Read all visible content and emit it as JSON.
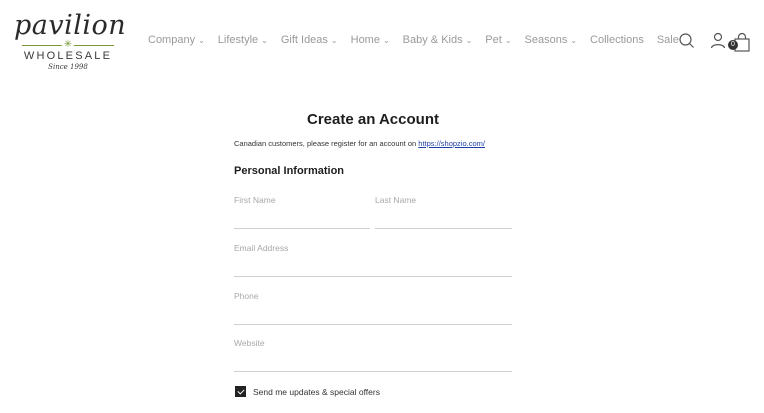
{
  "brand": {
    "name": "pavilion",
    "tagline": "WHOLESALE",
    "since": "Since 1998"
  },
  "nav": {
    "items": [
      {
        "label": "Company",
        "has_dropdown": true
      },
      {
        "label": "Lifestyle",
        "has_dropdown": true
      },
      {
        "label": "Gift Ideas",
        "has_dropdown": true
      },
      {
        "label": "Home",
        "has_dropdown": true
      },
      {
        "label": "Baby & Kids",
        "has_dropdown": true
      },
      {
        "label": "Pet",
        "has_dropdown": true
      },
      {
        "label": "Seasons",
        "has_dropdown": true
      },
      {
        "label": "Collections",
        "has_dropdown": false
      },
      {
        "label": "Sale",
        "has_dropdown": false
      }
    ]
  },
  "header_icons": {
    "search": "search-icon",
    "account": "user-icon",
    "cart": "shopping-bag-icon",
    "cart_count": "0"
  },
  "page": {
    "title": "Create an Account",
    "notice_text": "Canadian customers, please register for an account on ",
    "notice_link": "https://shopzio.com/",
    "section_title": "Personal Information"
  },
  "form": {
    "first_name": {
      "label": "First Name",
      "value": ""
    },
    "last_name": {
      "label": "Last Name",
      "value": ""
    },
    "email": {
      "label": "Email Address",
      "value": ""
    },
    "phone": {
      "label": "Phone",
      "value": ""
    },
    "website": {
      "label": "Website",
      "value": ""
    },
    "optin": {
      "label": "Send me updates & special offers",
      "checked": true
    }
  },
  "colors": {
    "accent_leaf": "#7a9a3a",
    "link": "#1f3fa8",
    "nav_text": "#9a9a9a"
  }
}
